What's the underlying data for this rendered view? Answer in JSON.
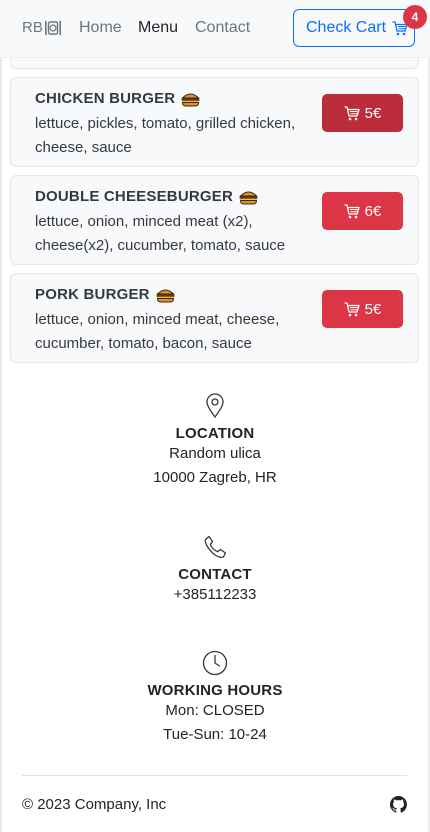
{
  "navbar": {
    "brand": "RB",
    "links": [
      {
        "label": "Home",
        "active": false
      },
      {
        "label": "Menu",
        "active": true
      },
      {
        "label": "Contact",
        "active": false
      }
    ],
    "cart_label": "Check Cart",
    "cart_count": "4"
  },
  "menu": {
    "items": [
      {
        "name": "CHICKEN BURGER",
        "description": "lettuce, pickles, tomato, grilled chicken, cheese, sauce",
        "price": "5€"
      },
      {
        "name": "DOUBLE CHEESEBURGER",
        "description": "lettuce, onion, minced meat (x2), cheese(x2), cucumber, tomato, sauce",
        "price": "6€"
      },
      {
        "name": "PORK BURGER",
        "description": "lettuce, onion, minced meat, cheese, cucumber, tomato, bacon, sauce",
        "price": "5€"
      }
    ]
  },
  "location": {
    "icon": "map-pin-icon",
    "title": "LOCATION",
    "street": "Random ulica",
    "city": "10000 Zagreb, HR"
  },
  "contact": {
    "icon": "phone-icon",
    "title": "CONTACT",
    "phone": "+385112233"
  },
  "hours": {
    "icon": "clock-icon",
    "title": "WORKING HOURS",
    "line1": "Mon: CLOSED",
    "line2": "Tue-Sun: 10-24"
  },
  "footer": {
    "copyright": "© 2023 Company, Inc",
    "icon": "github-icon"
  },
  "colors": {
    "primary": "#0d6efd",
    "danger": "#dc3545",
    "danger_hover": "#bb2d3b",
    "navbar_bg": "#f8f9fa"
  }
}
